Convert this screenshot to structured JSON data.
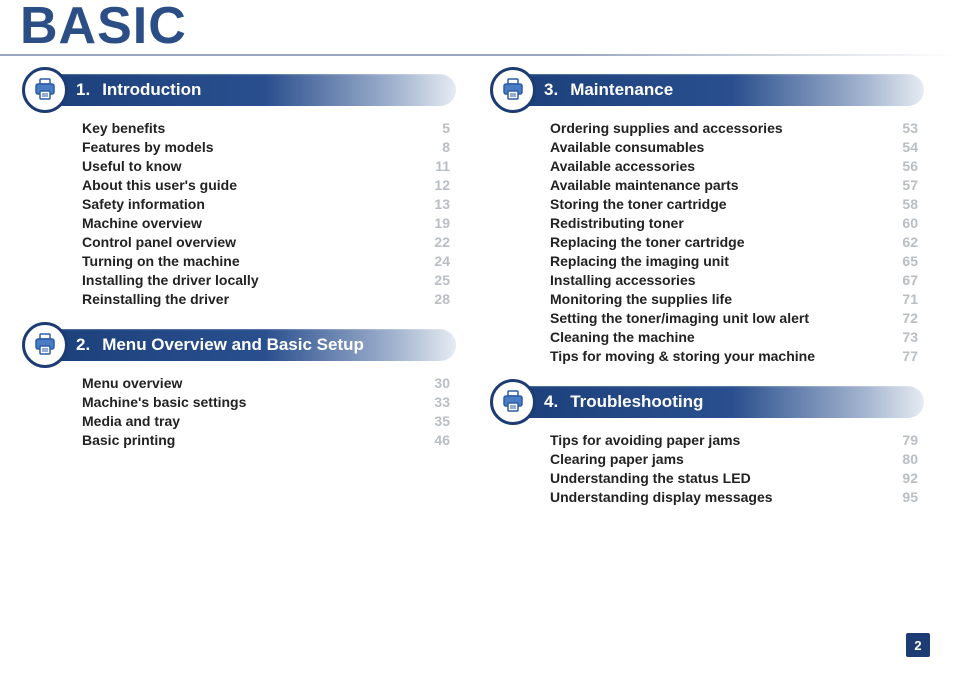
{
  "doc_title": "BASIC",
  "page_number": "2",
  "sections": [
    {
      "number": "1.",
      "title": "Introduction",
      "items": [
        {
          "label": "Key benefits",
          "page": "5"
        },
        {
          "label": "Features by models",
          "page": "8"
        },
        {
          "label": "Useful to know",
          "page": "11"
        },
        {
          "label": "About this user's guide",
          "page": "12"
        },
        {
          "label": "Safety information",
          "page": "13"
        },
        {
          "label": "Machine overview",
          "page": "19"
        },
        {
          "label": "Control panel overview",
          "page": "22"
        },
        {
          "label": "Turning on the machine",
          "page": "24"
        },
        {
          "label": "Installing the driver locally",
          "page": "25"
        },
        {
          "label": "Reinstalling the driver",
          "page": "28"
        }
      ]
    },
    {
      "number": "2.",
      "title": "Menu Overview and Basic Setup",
      "items": [
        {
          "label": "Menu overview",
          "page": "30"
        },
        {
          "label": "Machine's basic settings",
          "page": "33"
        },
        {
          "label": "Media and tray",
          "page": "35"
        },
        {
          "label": "Basic printing",
          "page": "46"
        }
      ]
    },
    {
      "number": "3.",
      "title": "Maintenance",
      "items": [
        {
          "label": "Ordering supplies and accessories",
          "page": "53"
        },
        {
          "label": "Available consumables",
          "page": "54"
        },
        {
          "label": "Available accessories",
          "page": "56"
        },
        {
          "label": "Available maintenance parts",
          "page": "57"
        },
        {
          "label": "Storing the toner cartridge",
          "page": "58"
        },
        {
          "label": "Redistributing toner",
          "page": "60"
        },
        {
          "label": "Replacing the toner cartridge",
          "page": "62"
        },
        {
          "label": "Replacing the imaging unit",
          "page": "65"
        },
        {
          "label": "Installing accessories",
          "page": "67"
        },
        {
          "label": "Monitoring the supplies life",
          "page": "71"
        },
        {
          "label": "Setting the toner/imaging unit low alert",
          "page": "72"
        },
        {
          "label": "Cleaning the machine",
          "page": "73"
        },
        {
          "label": "Tips for moving & storing your machine",
          "page": "77"
        }
      ]
    },
    {
      "number": "4.",
      "title": "Troubleshooting",
      "items": [
        {
          "label": "Tips for avoiding paper jams",
          "page": "79"
        },
        {
          "label": "Clearing paper jams",
          "page": "80"
        },
        {
          "label": "Understanding the status LED",
          "page": "92"
        },
        {
          "label": "Understanding display messages",
          "page": "95"
        }
      ]
    }
  ]
}
